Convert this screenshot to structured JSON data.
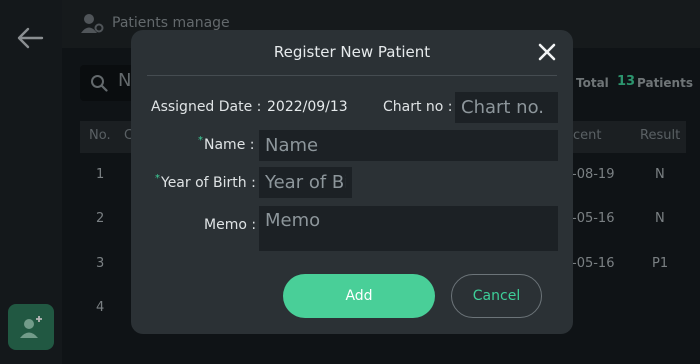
{
  "background": {
    "header_title": "Patients manage",
    "search_text": "N",
    "total_label": "Total",
    "total_count": "13",
    "total_unit": "Patients",
    "columns": {
      "no": "No.",
      "second": "C",
      "recent": "cent",
      "result": "Result"
    },
    "rows": [
      {
        "no": "1",
        "recent": "-08-19",
        "result": "N"
      },
      {
        "no": "2",
        "recent": "-05-16",
        "result": "N"
      },
      {
        "no": "3",
        "recent": "-05-16",
        "result": "P1"
      },
      {
        "no": "4",
        "recent": "",
        "result": ""
      }
    ]
  },
  "modal": {
    "title": "Register New Patient",
    "assigned_date_label": "Assigned Date :",
    "assigned_date_value": "2022/09/13",
    "chart_no_label": "Chart no :",
    "chart_no_placeholder": "Chart no.",
    "required_mark": "*",
    "name_label": "Name :",
    "name_placeholder": "Name",
    "year_label": "Year of Birth :",
    "year_placeholder": "Year of Birth",
    "memo_label": "Memo :",
    "memo_placeholder": "Memo",
    "add_label": "Add",
    "cancel_label": "Cancel"
  },
  "colors": {
    "accent": "#49cf98",
    "modal_bg": "#2b3135",
    "field_bg": "#1c2125",
    "page_bg": "#161b1f"
  },
  "icons": [
    "back-arrow-icon",
    "add-user-icon",
    "user-settings-icon",
    "search-icon",
    "close-icon"
  ]
}
